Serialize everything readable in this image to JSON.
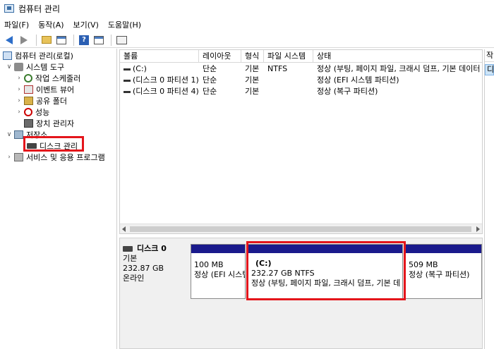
{
  "window": {
    "title": "컴퓨터 관리"
  },
  "menu": [
    "파일(F)",
    "동작(A)",
    "보기(V)",
    "도움말(H)"
  ],
  "tree": {
    "root": "컴퓨터 관리(로컬)",
    "system_tools": "시스템 도구",
    "task_scheduler": "작업 스케줄러",
    "event_viewer": "이벤트 뷰어",
    "shared_folders": "공유 폴더",
    "performance": "성능",
    "device_manager": "장치 관리자",
    "storage": "저장소",
    "disk_management": "디스크 관리",
    "services": "서비스 및 응용 프로그램"
  },
  "volume_list": {
    "columns": [
      "볼륨",
      "레이아웃",
      "형식",
      "파일 시스템",
      "상태"
    ],
    "rows": [
      [
        "(C:)",
        "단순",
        "기본",
        "NTFS",
        "정상 (부팅, 페이지 파일, 크래시 덤프, 기본 데이터"
      ],
      [
        "(디스크 0 파티션 1)",
        "단순",
        "기본",
        "",
        "정상 (EFI 시스템 파티션)"
      ],
      [
        "(디스크 0 파티션 4)",
        "단순",
        "기본",
        "",
        "정상 (복구 파티션)"
      ]
    ]
  },
  "disk": {
    "name": "디스크 0",
    "type": "기본",
    "size": "232.87 GB",
    "status": "온라인"
  },
  "partitions": [
    {
      "label": "",
      "size": "100 MB",
      "status": "정상 (EFI 시스템 파티션)"
    },
    {
      "label": "(C:)",
      "size": "232.27 GB NTFS",
      "status": "정상 (부팅, 페이지 파일, 크래시 덤프, 기본 데이터 파티션)"
    },
    {
      "label": "",
      "size": "509 MB",
      "status": "정상 (복구 파티션)"
    }
  ],
  "actions": {
    "header": "작",
    "selected": "디"
  }
}
